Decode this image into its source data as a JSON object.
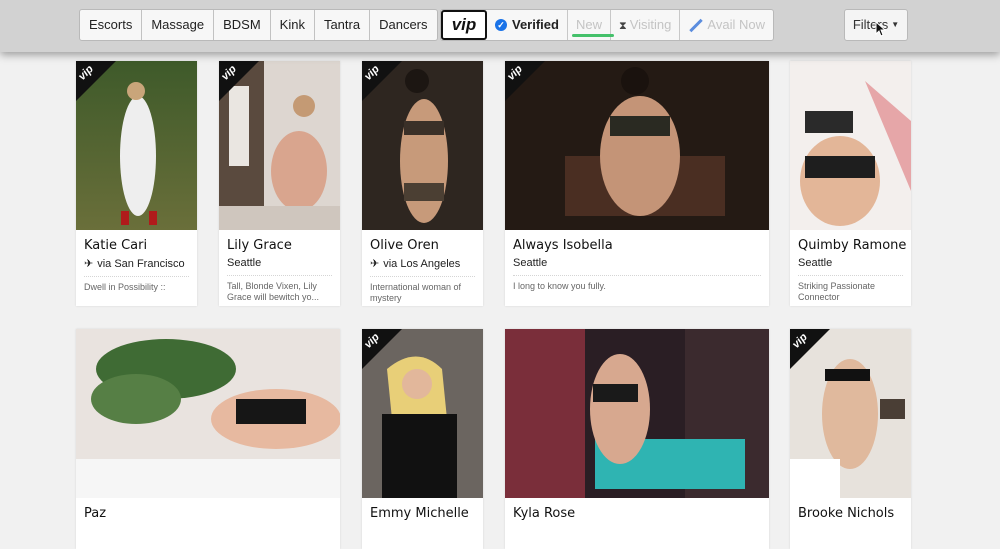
{
  "categories": [
    "Escorts",
    "Massage",
    "BDSM",
    "Kink",
    "Tantra",
    "Dancers"
  ],
  "filters": {
    "vip": "vip",
    "verified": "Verified",
    "new": "New",
    "visiting": "Visiting",
    "avail_now": "Avail Now",
    "filters_button": "Filters"
  },
  "colors": {
    "verified": "#1a73e8",
    "new_underline": "#45c16b",
    "vip_badge": "#111111"
  },
  "profiles": [
    {
      "name": "Katie Cari",
      "visiting": true,
      "location": "via San Francisco",
      "tagline": "Dwell in Possibility ::",
      "vip": true
    },
    {
      "name": "Lily Grace",
      "visiting": false,
      "location": "Seattle",
      "tagline": "Tall, Blonde Vixen, Lily Grace will bewitch yo...",
      "vip": true
    },
    {
      "name": "Olive Oren",
      "visiting": true,
      "location": "via Los Angeles",
      "tagline": "International woman of mystery",
      "vip": true
    },
    {
      "name": "Always Isobella",
      "visiting": false,
      "location": "Seattle",
      "tagline": "I long to know you fully.",
      "vip": true
    },
    {
      "name": "Quimby Ramone",
      "visiting": false,
      "location": "Seattle",
      "tagline": "Striking Passionate Connector",
      "vip": false
    },
    {
      "name": "Paz",
      "vip": false
    },
    {
      "name": "Emmy Michelle",
      "vip": true
    },
    {
      "name": "Kyla Rose",
      "vip": false
    },
    {
      "name": "Brooke Nichols",
      "vip": true
    }
  ]
}
